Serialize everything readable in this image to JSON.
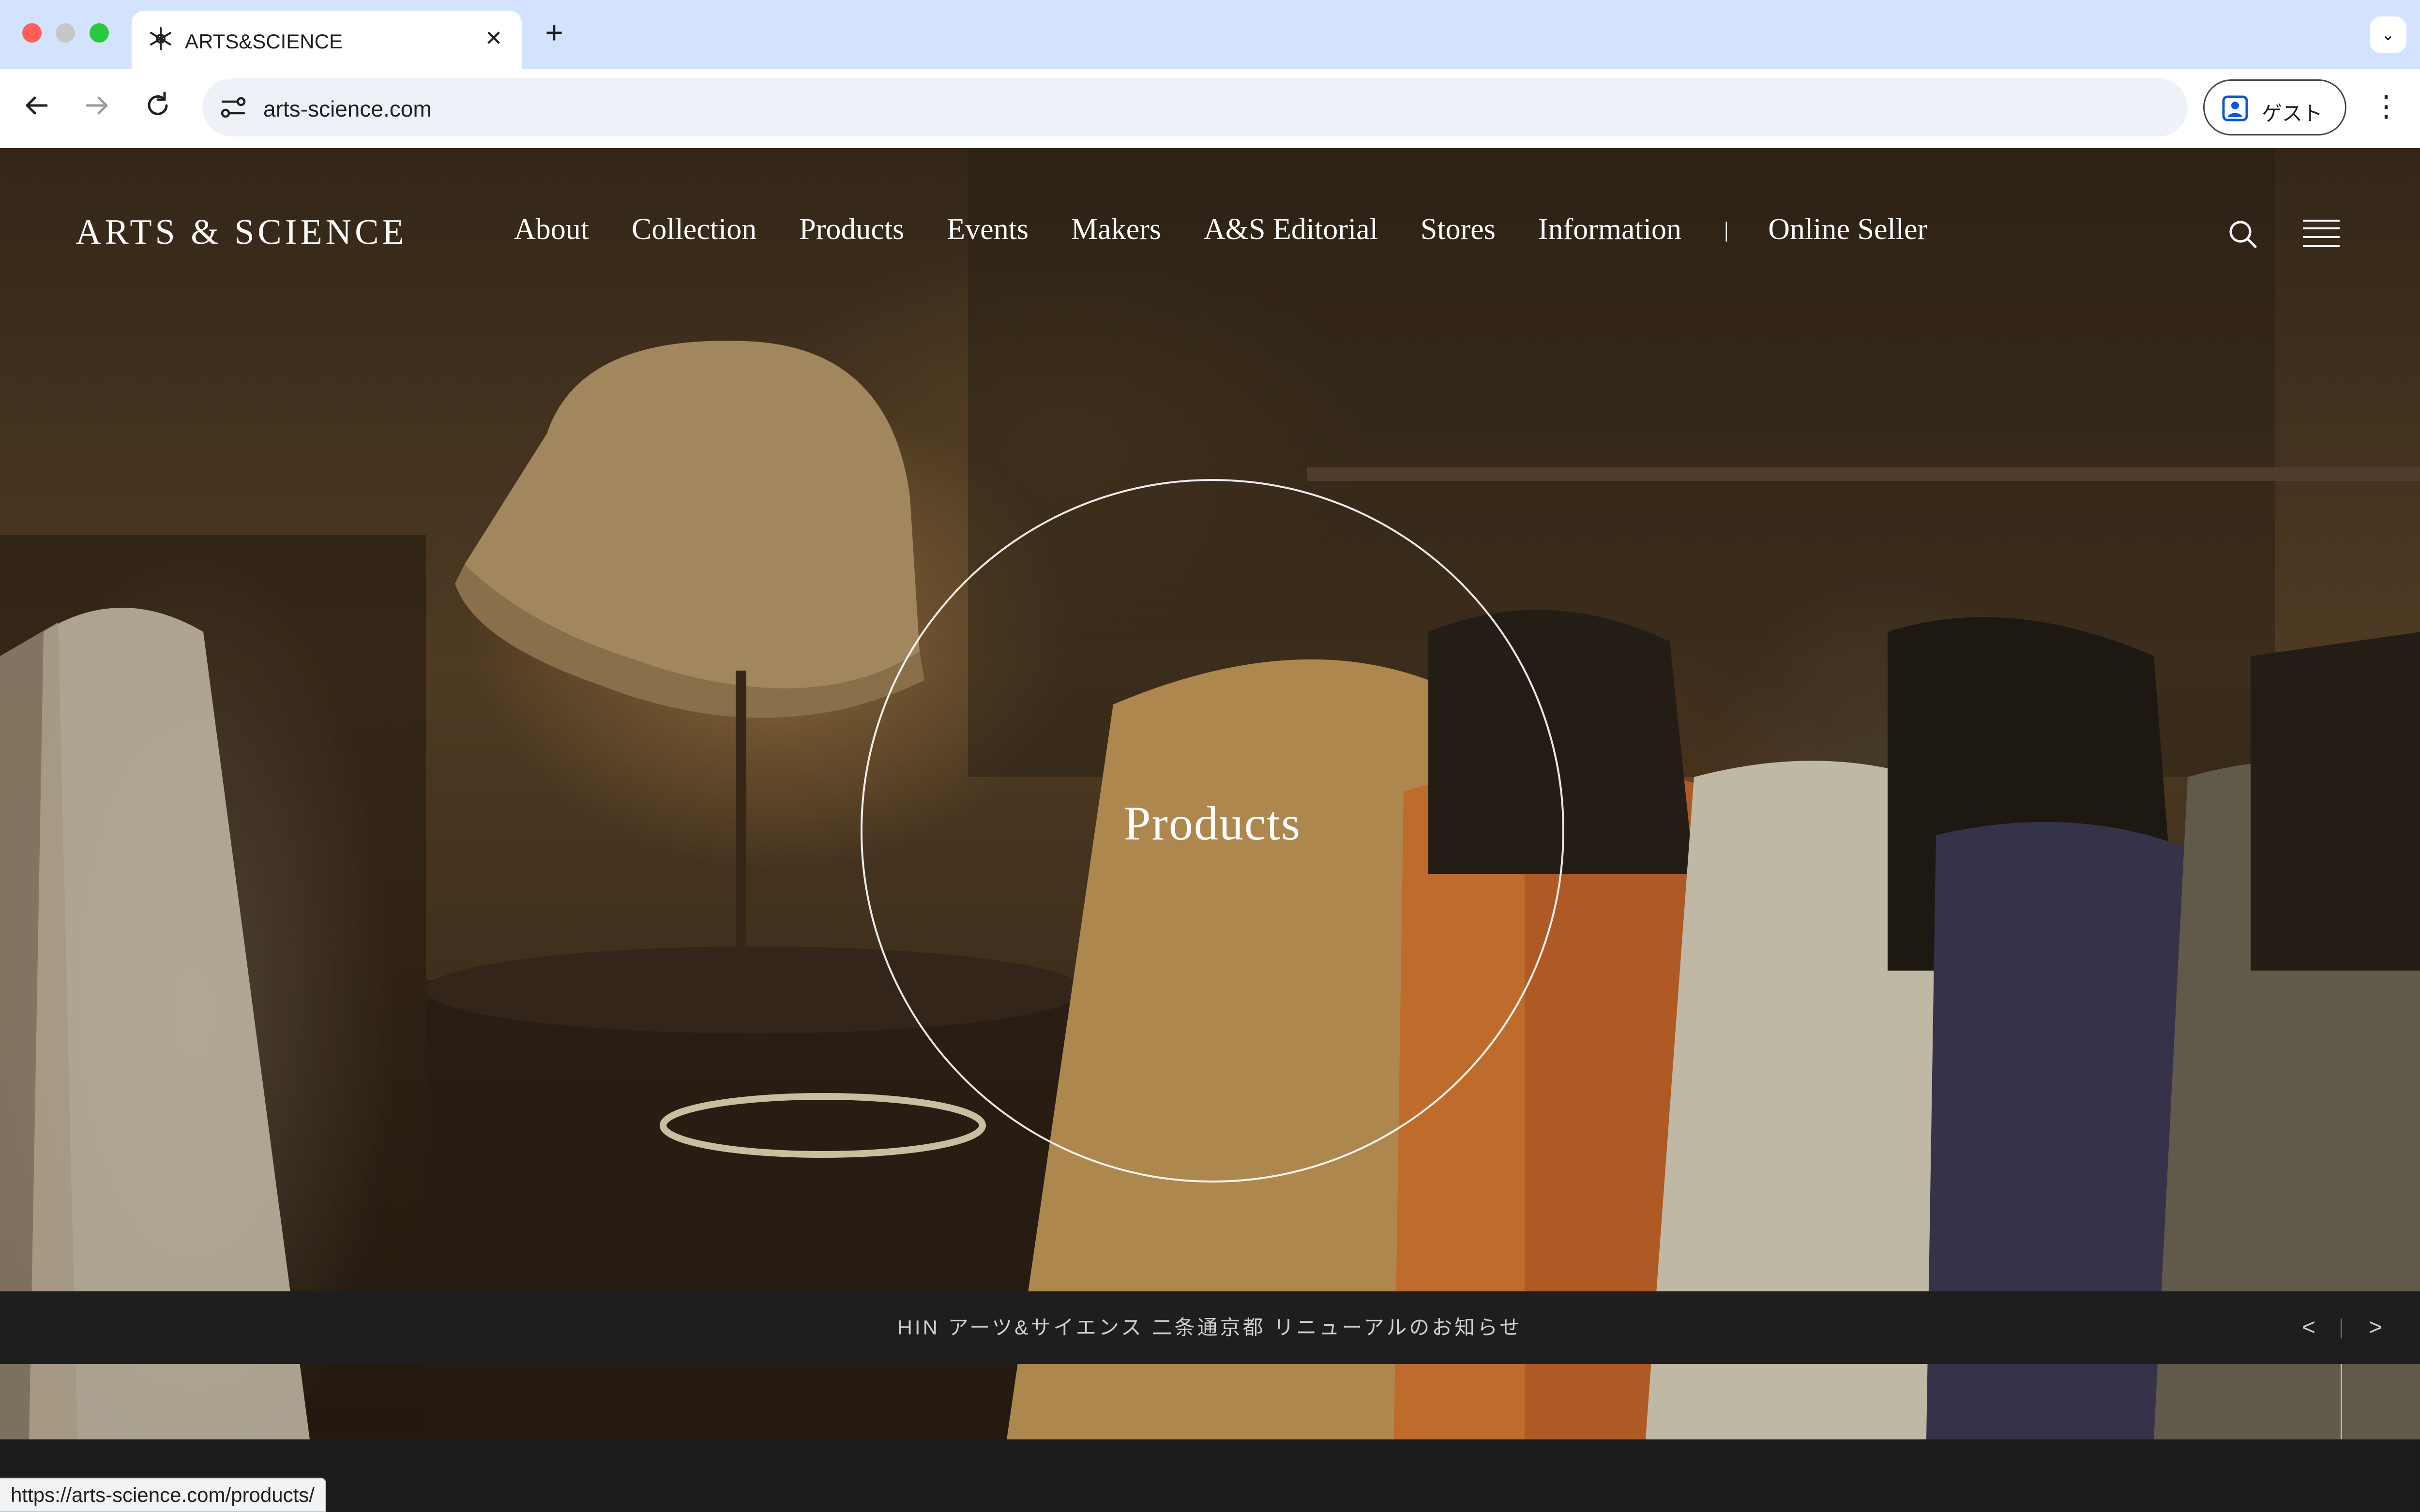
{
  "browser": {
    "tab_title": "ARTS&SCIENCE",
    "tab_close": "✕",
    "new_tab": "+",
    "tab_list": "⌄",
    "url": "arts-science.com",
    "profile_label": "ゲスト",
    "menu": "⋮",
    "status_url": "https://arts-science.com/products/"
  },
  "site": {
    "logo": "ARTS & SCIENCE",
    "nav": [
      {
        "label": "About"
      },
      {
        "label": "Collection"
      },
      {
        "label": "Products"
      },
      {
        "label": "Events"
      },
      {
        "label": "Makers"
      },
      {
        "label": "A&S Editorial"
      },
      {
        "label": "Stores"
      },
      {
        "label": "Information"
      },
      {
        "label": "|"
      },
      {
        "label": "Online Seller"
      }
    ]
  },
  "hero": {
    "title": "Products"
  },
  "news": {
    "text": "HIN アーツ&サイエンス 二条通京都 リニューアルのお知らせ",
    "prev": "<",
    "next": ">"
  },
  "colors": {
    "tab_bar": "#d3e3fd",
    "toolbar": "#ffffff",
    "omnibox": "#eef1f8",
    "news_bar": "#1e1e1e",
    "nav_text": "#ffffff"
  }
}
